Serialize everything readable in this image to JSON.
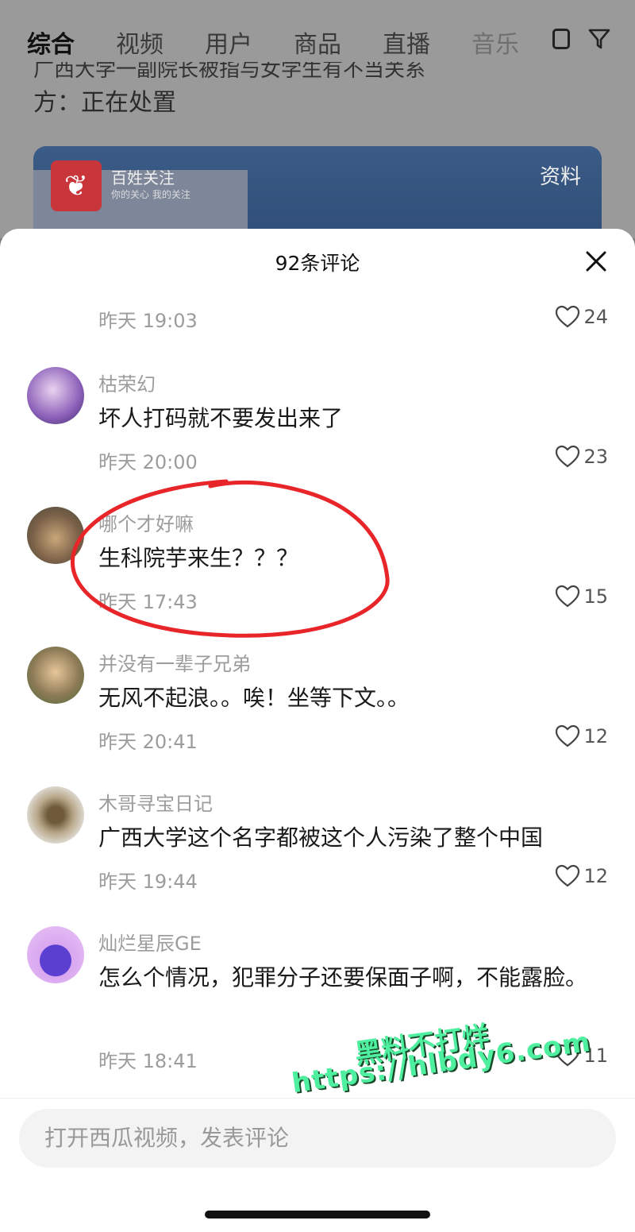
{
  "tabs": [
    "综合",
    "视频",
    "用户",
    "商品",
    "直播",
    "音乐"
  ],
  "article": {
    "title_cut": "广西大学一副院长被指与女学生有不当关系",
    "title_line2": "方：正在处置",
    "thumb_label": "资料",
    "logo_text": "百姓关注",
    "logo_sub": "你的关心 我的关注"
  },
  "sheet": {
    "title": "92条评论",
    "first_timestamp": "昨天 19:03",
    "first_likes": "24"
  },
  "comments": [
    {
      "user": "枯荣幻",
      "text": "坏人打码就不要发出来了",
      "time": "昨天 20:00",
      "likes": "23"
    },
    {
      "user": "哪个才好嘛",
      "text": "生科院芋来生？？？",
      "time": "昨天 17:43",
      "likes": "15"
    },
    {
      "user": "并没有一辈子兄弟",
      "text": "无风不起浪。。唉！坐等下文。。",
      "time": "昨天 20:41",
      "likes": "12"
    },
    {
      "user": "木哥寻宝日记",
      "text": "广西大学这个名字都被这个人污染了整个中国",
      "time": "昨天 19:44",
      "likes": "12"
    },
    {
      "user": "灿烂星辰GE",
      "text": "怎么个情况，犯罪分子还要保面子啊，不能露脸。",
      "time": "昨天 18:41",
      "likes": "11"
    }
  ],
  "input_placeholder": "打开西瓜视频，发表评论",
  "watermark": {
    "line1": "黑料不打烊",
    "line2": "https://hlbdy6.com"
  },
  "colors": {
    "annotation": "#e8262a",
    "watermark": "#4ef0a0"
  }
}
